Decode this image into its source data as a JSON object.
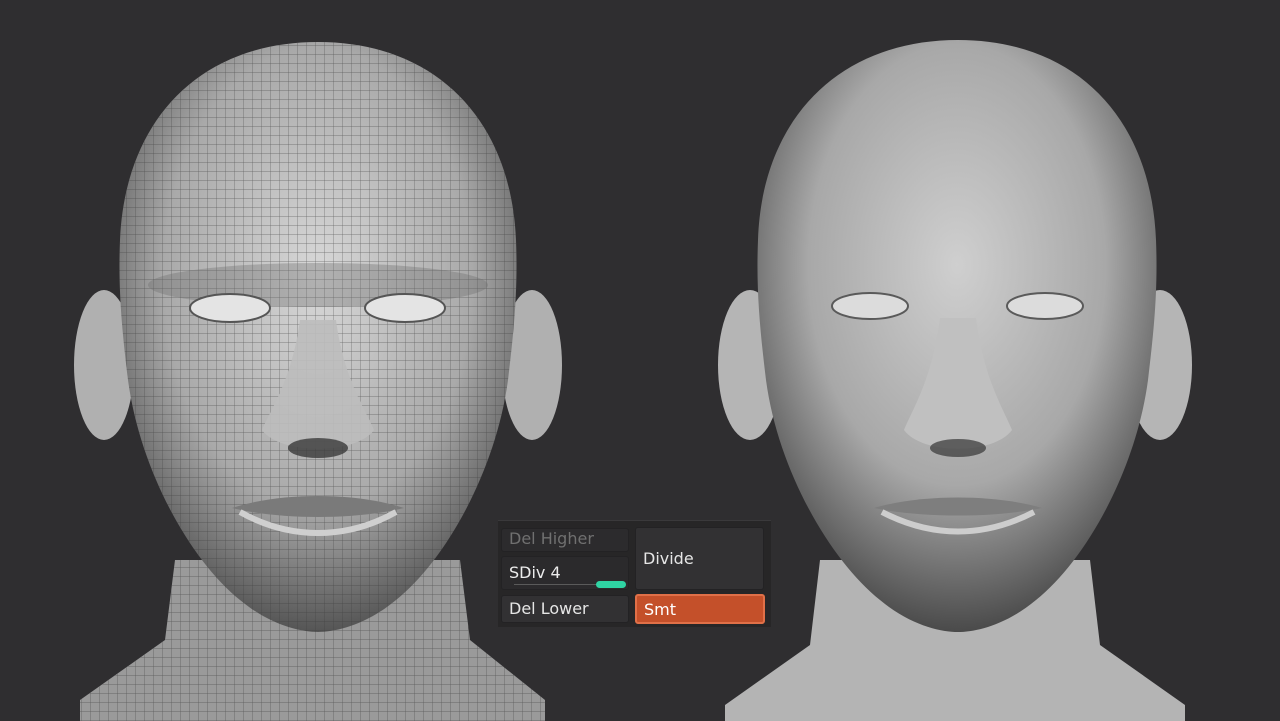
{
  "viewport": {
    "background": "#2f2e30",
    "models": [
      {
        "name": "wireframe-head",
        "display": "polyframe"
      },
      {
        "name": "smooth-head",
        "display": "shaded"
      }
    ]
  },
  "subdivision_panel": {
    "del_higher_label": "Del Higher",
    "sdiv_label": "SDiv 4",
    "sdiv_value": 4,
    "sdiv_max": 4,
    "divide_label": "Divide",
    "del_lower_label": "Del Lower",
    "smt_label": "Smt",
    "smt_active": true,
    "accent_color": "#c4502a",
    "slider_color": "#2fd3a3"
  }
}
